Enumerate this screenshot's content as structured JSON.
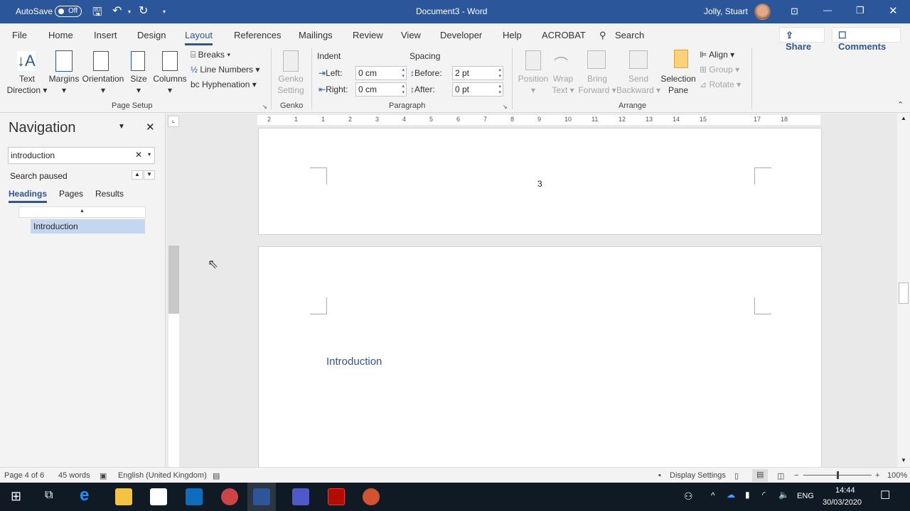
{
  "titlebar": {
    "autosave": "AutoSave",
    "autosave_state": "Off",
    "title": "Document3  -  Word",
    "user": "Jolly, Stuart",
    "color": "#2b579a"
  },
  "tabs": [
    "File",
    "Home",
    "Insert",
    "Design",
    "Layout",
    "References",
    "Mailings",
    "Review",
    "View",
    "Developer",
    "Help",
    "ACROBAT"
  ],
  "active_tab": "Layout",
  "search": "Search",
  "share": "Share",
  "comments": "Comments",
  "ribbon": {
    "page_setup": {
      "text_direction": [
        "Text",
        "Direction"
      ],
      "margins": "Margins",
      "orientation": "Orientation",
      "size": "Size",
      "columns": "Columns",
      "breaks": "Breaks",
      "line_numbers": "Line Numbers",
      "hyphenation": "Hyphenation",
      "group": "Page Setup"
    },
    "genko": {
      "setting": [
        "Genko",
        "Setting"
      ],
      "group": "Genko"
    },
    "paragraph": {
      "indent": "Indent",
      "spacing": "Spacing",
      "left_label": "Left:",
      "left_value": "0 cm",
      "right_label": "Right:",
      "right_value": "0 cm",
      "before_label": "Before:",
      "before_value": "2 pt",
      "after_label": "After:",
      "after_value": "0 pt",
      "group": "Paragraph"
    },
    "arrange": {
      "position": "Position",
      "wrap": [
        "Wrap",
        "Text"
      ],
      "bring": [
        "Bring",
        "Forward"
      ],
      "send": [
        "Send",
        "Backward"
      ],
      "selection": [
        "Selection",
        "Pane"
      ],
      "align": "Align",
      "group_btn": "Group",
      "rotate": "Rotate",
      "group": "Arrange"
    }
  },
  "ruler": [
    "2",
    "1",
    "1",
    "2",
    "3",
    "4",
    "5",
    "6",
    "7",
    "8",
    "9",
    "10",
    "11",
    "12",
    "13",
    "14",
    "15",
    "17",
    "18"
  ],
  "navigation": {
    "title": "Navigation",
    "search_value": "introduction",
    "status": "Search paused",
    "tabs": [
      "Headings",
      "Pages",
      "Results"
    ],
    "active_tab": "Headings",
    "headings": [
      "Introduction"
    ]
  },
  "document": {
    "page_number": "3",
    "heading": "Introduction"
  },
  "statusbar": {
    "page": "Page 4 of 6",
    "words": "45 words",
    "language": "English (United Kingdom)",
    "display": "Display Settings",
    "zoom": "100%",
    "zoom_percent": 100
  },
  "taskbar": {
    "lang": "ENG",
    "time": "14:44",
    "date": "30/03/2020"
  }
}
